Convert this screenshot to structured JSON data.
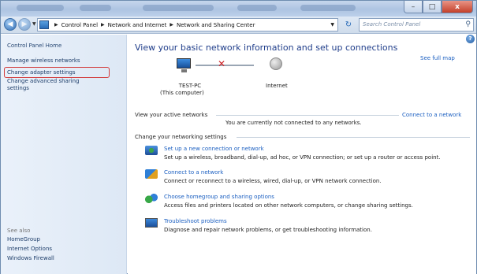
{
  "window": {
    "caption_buttons": {
      "minimize": "–",
      "maximize": "□",
      "close": "x"
    }
  },
  "nav": {
    "back_icon": "back-arrow-icon",
    "forward_icon": "forward-arrow-icon",
    "breadcrumb": [
      "Control Panel",
      "Network and Internet",
      "Network and Sharing Center"
    ],
    "search_placeholder": "Search Control Panel"
  },
  "sidebar": {
    "home": "Control Panel Home",
    "links": [
      "Manage wireless networks",
      "Change adapter settings",
      "Change advanced sharing",
      "settings"
    ],
    "see_also_title": "See also",
    "see_also": [
      "HomeGroup",
      "Internet Options",
      "Windows Firewall"
    ]
  },
  "main": {
    "heading": "View your basic network information and set up connections",
    "full_map": "See full map",
    "computer_name": "TEST-PC",
    "computer_sub": "(This computer)",
    "internet_label": "Internet",
    "active_networks_title": "View your active networks",
    "connect_to_network": "Connect to a network",
    "not_connected": "You are currently not connected to any networks.",
    "settings_title": "Change your networking settings",
    "tasks": [
      {
        "link": "Set up a new connection or network",
        "desc": "Set up a wireless, broadband, dial-up, ad hoc, or VPN connection; or set up a router or access point.",
        "icon": "setup-connection-icon"
      },
      {
        "link": "Connect to a network",
        "desc": "Connect or reconnect to a wireless, wired, dial-up, or VPN network connection.",
        "icon": "connect-network-icon"
      },
      {
        "link": "Choose homegroup and sharing options",
        "desc": "Access files and printers located on other network computers, or change sharing settings.",
        "icon": "homegroup-icon"
      },
      {
        "link": "Troubleshoot problems",
        "desc": "Diagnose and repair network problems, or get troubleshooting information.",
        "icon": "troubleshoot-icon"
      }
    ]
  },
  "colors": {
    "link": "#1b5fc1",
    "heading": "#1f3d8a",
    "highlight_border": "#d23b3b",
    "disconnect": "#d0262a"
  }
}
